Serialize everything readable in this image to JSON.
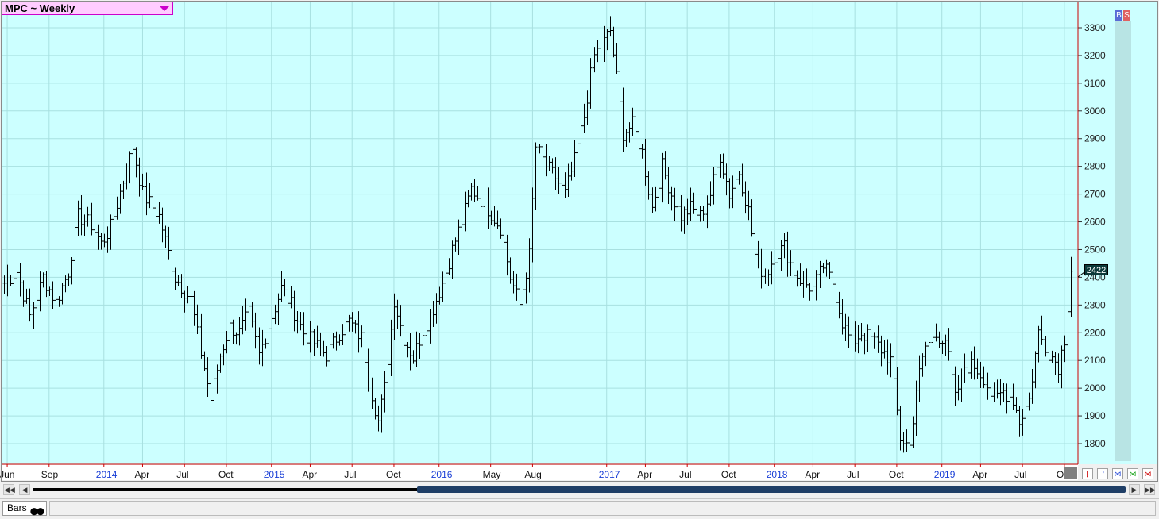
{
  "symbol": {
    "label": "MPC ~ Weekly"
  },
  "badges": {
    "buy": "B",
    "sell": "S",
    "buy_color": "#5a6bd6",
    "sell_color": "#e06060"
  },
  "last_price": {
    "label": "2422"
  },
  "status": {
    "tab_label": "Bars"
  },
  "colors": {
    "plot_bg": "#ccffff",
    "grid": "#a8e0e0",
    "bars": "#000000",
    "axis_red": "#cc0000",
    "year_label": "#1a3fd6"
  },
  "chart_data": {
    "type": "ohlc",
    "title": "MPC ~ Weekly",
    "ylim": [
      1740,
      3400
    ],
    "y_ticks": [
      1800,
      1900,
      2000,
      2100,
      2200,
      2300,
      2400,
      2500,
      2600,
      2700,
      2800,
      2900,
      3000,
      3100,
      3200,
      3300
    ],
    "x_labels": [
      {
        "label": "Jun",
        "index": 1,
        "year": false
      },
      {
        "label": "Sep",
        "index": 14,
        "year": false
      },
      {
        "label": "2014",
        "index": 31,
        "year": true
      },
      {
        "label": "Apr",
        "index": 43,
        "year": false
      },
      {
        "label": "Jul",
        "index": 56,
        "year": false
      },
      {
        "label": "Oct",
        "index": 69,
        "year": false
      },
      {
        "label": "2015",
        "index": 83,
        "year": true
      },
      {
        "label": "Apr",
        "index": 95,
        "year": false
      },
      {
        "label": "Jul",
        "index": 108,
        "year": false
      },
      {
        "label": "Oct",
        "index": 121,
        "year": false
      },
      {
        "label": "2016",
        "index": 135,
        "year": true
      },
      {
        "label": "May",
        "index": 151,
        "year": false
      },
      {
        "label": "Aug",
        "index": 164,
        "year": false
      },
      {
        "label": "2017",
        "index": 187,
        "year": true
      },
      {
        "label": "Apr",
        "index": 199,
        "year": false
      },
      {
        "label": "Jul",
        "index": 212,
        "year": false
      },
      {
        "label": "Oct",
        "index": 225,
        "year": false
      },
      {
        "label": "2018",
        "index": 239,
        "year": true
      },
      {
        "label": "Apr",
        "index": 251,
        "year": false
      },
      {
        "label": "Jul",
        "index": 264,
        "year": false
      },
      {
        "label": "Oct",
        "index": 277,
        "year": false
      },
      {
        "label": "2019",
        "index": 291,
        "year": true
      },
      {
        "label": "Apr",
        "index": 303,
        "year": false
      },
      {
        "label": "Jul",
        "index": 316,
        "year": false
      },
      {
        "label": "Oct",
        "index": 329,
        "year": false
      }
    ],
    "bars_count": 332,
    "last_value": 2422,
    "anchors": [
      [
        0,
        2380
      ],
      [
        4,
        2420
      ],
      [
        8,
        2260
      ],
      [
        12,
        2400
      ],
      [
        16,
        2310
      ],
      [
        20,
        2420
      ],
      [
        23,
        2620
      ],
      [
        27,
        2590
      ],
      [
        30,
        2520
      ],
      [
        33,
        2580
      ],
      [
        37,
        2750
      ],
      [
        40,
        2870
      ],
      [
        43,
        2700
      ],
      [
        48,
        2620
      ],
      [
        53,
        2400
      ],
      [
        58,
        2320
      ],
      [
        61,
        2130
      ],
      [
        64,
        1960
      ],
      [
        67,
        2120
      ],
      [
        70,
        2220
      ],
      [
        73,
        2200
      ],
      [
        76,
        2270
      ],
      [
        79,
        2120
      ],
      [
        83,
        2260
      ],
      [
        86,
        2360
      ],
      [
        89,
        2300
      ],
      [
        93,
        2200
      ],
      [
        97,
        2150
      ],
      [
        100,
        2120
      ],
      [
        104,
        2200
      ],
      [
        107,
        2240
      ],
      [
        111,
        2180
      ],
      [
        114,
        1980
      ],
      [
        116,
        1880
      ],
      [
        118,
        2000
      ],
      [
        121,
        2320
      ],
      [
        124,
        2180
      ],
      [
        127,
        2110
      ],
      [
        130,
        2210
      ],
      [
        133,
        2290
      ],
      [
        136,
        2380
      ],
      [
        139,
        2500
      ],
      [
        142,
        2600
      ],
      [
        145,
        2720
      ],
      [
        148,
        2680
      ],
      [
        151,
        2630
      ],
      [
        154,
        2580
      ],
      [
        157,
        2400
      ],
      [
        160,
        2300
      ],
      [
        163,
        2480
      ],
      [
        165,
        2870
      ],
      [
        168,
        2800
      ],
      [
        171,
        2760
      ],
      [
        174,
        2700
      ],
      [
        177,
        2820
      ],
      [
        180,
        2980
      ],
      [
        183,
        3200
      ],
      [
        186,
        3250
      ],
      [
        188,
        3290
      ],
      [
        190,
        3120
      ],
      [
        192,
        2920
      ],
      [
        195,
        2950
      ],
      [
        198,
        2850
      ],
      [
        201,
        2650
      ],
      [
        204,
        2800
      ],
      [
        207,
        2700
      ],
      [
        210,
        2620
      ],
      [
        213,
        2650
      ],
      [
        216,
        2620
      ],
      [
        219,
        2700
      ],
      [
        222,
        2840
      ],
      [
        225,
        2700
      ],
      [
        228,
        2780
      ],
      [
        231,
        2640
      ],
      [
        233,
        2480
      ],
      [
        236,
        2400
      ],
      [
        239,
        2480
      ],
      [
        242,
        2510
      ],
      [
        245,
        2420
      ],
      [
        248,
        2380
      ],
      [
        251,
        2360
      ],
      [
        254,
        2440
      ],
      [
        257,
        2380
      ],
      [
        260,
        2240
      ],
      [
        263,
        2160
      ],
      [
        266,
        2200
      ],
      [
        269,
        2180
      ],
      [
        272,
        2140
      ],
      [
        275,
        2100
      ],
      [
        278,
        1820
      ],
      [
        281,
        1790
      ],
      [
        283,
        2000
      ],
      [
        286,
        2150
      ],
      [
        289,
        2190
      ],
      [
        292,
        2180
      ],
      [
        295,
        1960
      ],
      [
        298,
        2080
      ],
      [
        301,
        2080
      ],
      [
        304,
        2040
      ],
      [
        307,
        1950
      ],
      [
        310,
        1990
      ],
      [
        313,
        1960
      ],
      [
        315,
        1880
      ],
      [
        318,
        1960
      ],
      [
        321,
        2200
      ],
      [
        324,
        2130
      ],
      [
        327,
        2080
      ],
      [
        329,
        2180
      ],
      [
        331,
        2422
      ]
    ]
  }
}
